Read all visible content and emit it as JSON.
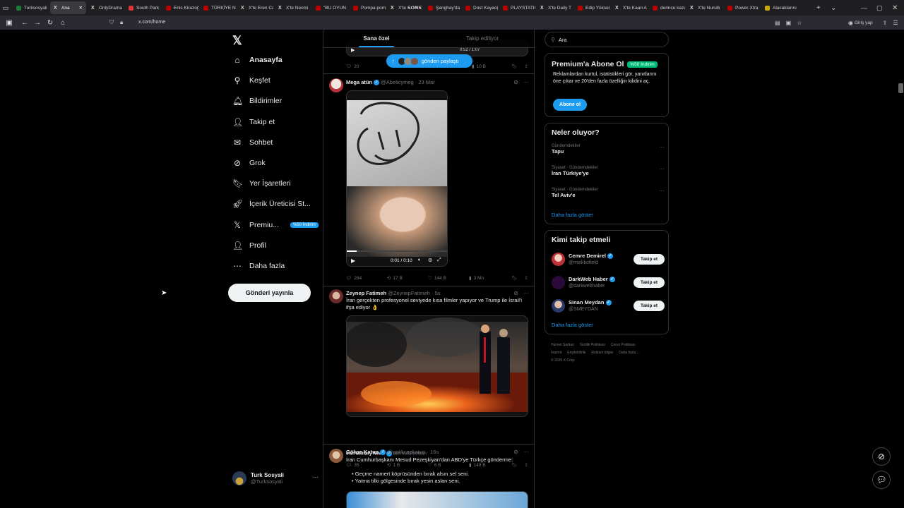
{
  "browser": {
    "tabs": [
      {
        "label": "Turksosyali",
        "fav": "g"
      },
      {
        "label": "Ana",
        "fav": "x",
        "active": true
      },
      {
        "label": "OnlyDrama",
        "fav": "x"
      },
      {
        "label": "South Park",
        "fav": "sp"
      },
      {
        "label": "Enis Kirazoğ",
        "fav": ""
      },
      {
        "label": "TÜRKİYE NA",
        "fav": ""
      },
      {
        "label": "X'te Eren Ca",
        "fav": "x"
      },
      {
        "label": "X'te Necmi",
        "fav": "x"
      },
      {
        "label": "\"BU OYUN",
        "fav": ""
      },
      {
        "label": "Pompa porn",
        "fav": ""
      },
      {
        "label": "X'te 𝙎𝙊𝙉𝙎",
        "fav": "x"
      },
      {
        "label": "Şanghay'da",
        "fav": ""
      },
      {
        "label": "Dost Kayaoğ",
        "fav": ""
      },
      {
        "label": "PLAYSTATIO",
        "fav": ""
      },
      {
        "label": "X'te Daily T",
        "fav": "x"
      },
      {
        "label": "Edip Yüksel",
        "fav": ""
      },
      {
        "label": "X'te Kaan A",
        "fav": "x"
      },
      {
        "label": "derince kaza",
        "fav": ""
      },
      {
        "label": "X'te Nurullı",
        "fav": "x"
      },
      {
        "label": "Power-Xtra",
        "fav": ""
      },
      {
        "label": "Alacaklarını",
        "fav": "y"
      }
    ],
    "url": "x.com/home",
    "signin_label": "Giriş yap"
  },
  "sidebar": {
    "logo": "𝕏",
    "items": [
      {
        "label": "Anasayfa",
        "icon": "⌂",
        "name": "home"
      },
      {
        "label": "Keşfet",
        "icon": "⚲",
        "name": "explore"
      },
      {
        "label": "Bildirimler",
        "icon": "🔔︎",
        "name": "notifications"
      },
      {
        "label": "Takip et",
        "icon": "👤︎",
        "name": "follow"
      },
      {
        "label": "Sohbet",
        "icon": "✉",
        "name": "chat"
      },
      {
        "label": "Grok",
        "icon": "⊘",
        "name": "grok"
      },
      {
        "label": "Yer İşaretleri",
        "icon": "🔖︎",
        "name": "bookmarks"
      },
      {
        "label": "İçerik Üreticisi St...",
        "icon": "🚀︎",
        "name": "creator-studio"
      },
      {
        "label": "Premiu...",
        "icon": "𝕏",
        "name": "premium"
      },
      {
        "label": "Profil",
        "icon": "👤︎",
        "name": "profile"
      },
      {
        "label": "Daha fazla",
        "icon": "⋯",
        "name": "more"
      }
    ],
    "premium_badge": "%50 İndirim",
    "post_button": "Gönderi yayınla",
    "account": {
      "name": "Turk Sosyali",
      "handle": "@Turksosyali",
      "more": "···"
    }
  },
  "feed": {
    "tabs": [
      "Sana özel",
      "Takip ediliyor"
    ],
    "new_posts_label": "gönderi paylaştı",
    "top_post": {
      "replies": "20",
      "views": "10 B",
      "video_time": "0:52 / 1:07"
    },
    "posts": [
      {
        "name": "Mega atün",
        "handle": "@Abelicymeg",
        "time": "23 Mar",
        "text": "",
        "video_time": "0:01 / 0:10",
        "replies": "284",
        "reposts": "17 B",
        "likes": "144 B",
        "views": "3 Mn"
      },
      {
        "name": "Zeynep Fatimeh",
        "handle": "@ZeynepFatimeh",
        "time": "5s",
        "text": "İran gerçekten profesyonel seviyede kısa filmler yapıyor ve Trump ile İsrail'i ifşa ediyor 👌",
        "source": "Iran Military News",
        "source_by": "adlı kullanıcıdan",
        "replies": "35",
        "reposts": "1 B",
        "likes": "6 B",
        "views": "149 B"
      },
      {
        "name": "Gökçe Katun",
        "handle": "@gokkceekatun",
        "time": "16s",
        "text": "İran Cumhurbaşkanı Mesud Pezeşkiyan'dan ABD'ye Türkçe gönderme:",
        "bullets": [
          "Geçme namert köprüsünden bırak alsın sel seni.",
          "Yatma tilki gölgesinde bırak yesin aslan seni."
        ]
      }
    ]
  },
  "right": {
    "search_placeholder": "Ara",
    "premium": {
      "title": "Premium'a Abone Ol",
      "badge": "%50 İndirim",
      "text": "Reklamlardan kurtul, istatistikleri gör, yanıtlarını öne çıkar ve 20'den fazla özelliğin kilidini aç.",
      "button": "Abone ol"
    },
    "trends": {
      "title": "Neler oluyor?",
      "items": [
        {
          "context": "Gündemdekiler",
          "name": "Tapu"
        },
        {
          "context": "Siyaset · Gündemdekiler",
          "name": "İran Türkiye'ye"
        },
        {
          "context": "Siyaset · Gündemdekiler",
          "name": "Tel Aviv'e"
        }
      ],
      "show_more": "Daha fazla göster"
    },
    "who_to_follow": {
      "title": "Kimi takip etmeli",
      "items": [
        {
          "name": "Cemre Demirel",
          "handle": "@msikkofield"
        },
        {
          "name": "DarkWeb Haber",
          "handle": "@darkwebhaber"
        },
        {
          "name": "Sinan Meydan",
          "handle": "@SMEYDAN"
        }
      ],
      "follow_label": "Takip et",
      "show_more": "Daha fazla göster"
    },
    "footer": [
      "Hizmet Şartları",
      "Gizlilik Politikası",
      "Çerez Politikası",
      "İmprint",
      "Erişilebilirlik",
      "Reklam bilgisi",
      "Daha fazla ...",
      "© 2026 X Corp."
    ]
  },
  "colors": {
    "accent": "#1d9bf0",
    "background": "#000000",
    "border": "#2f3336",
    "muted": "#71767b",
    "premium_badge": "#00ba7c"
  }
}
